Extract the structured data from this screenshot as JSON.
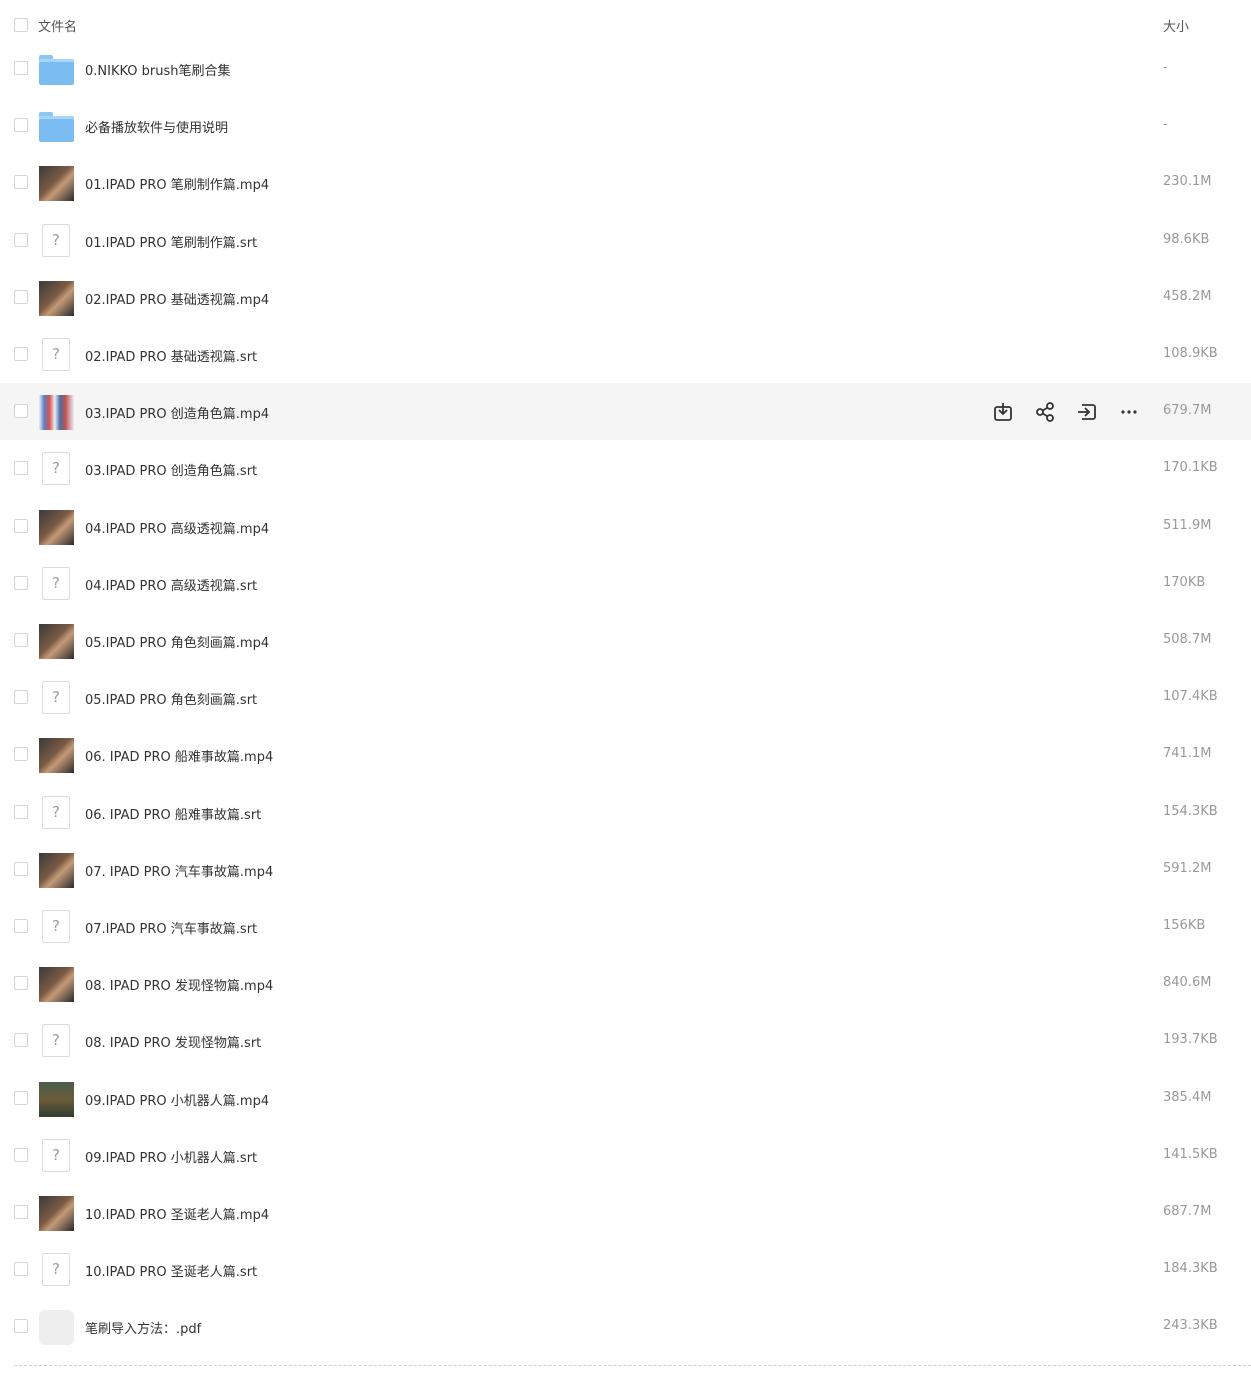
{
  "header": {
    "name_label": "文件名",
    "size_label": "大小"
  },
  "actions_icons": [
    "download-icon",
    "share-icon",
    "move-icon",
    "more-icon"
  ],
  "files": [
    {
      "name": "0.NIKKO brush笔刷合集",
      "size": "-",
      "type": "folder"
    },
    {
      "name": "必备播放软件与使用说明",
      "size": "-",
      "type": "folder"
    },
    {
      "name": "01.IPAD PRO 笔刷制作篇.mp4",
      "size": "230.1M",
      "type": "video"
    },
    {
      "name": "01.IPAD PRO 笔刷制作篇.srt",
      "size": "98.6KB",
      "type": "unknown"
    },
    {
      "name": "02.IPAD PRO 基础透视篇.mp4",
      "size": "458.2M",
      "type": "video"
    },
    {
      "name": "02.IPAD PRO 基础透视篇.srt",
      "size": "108.9KB",
      "type": "unknown"
    },
    {
      "name": "03.IPAD PRO 创造角色篇.mp4",
      "size": "679.7M",
      "type": "video-multi"
    },
    {
      "name": "03.IPAD PRO 创造角色篇.srt",
      "size": "170.1KB",
      "type": "unknown"
    },
    {
      "name": "04.IPAD PRO 高级透视篇.mp4",
      "size": "511.9M",
      "type": "video"
    },
    {
      "name": "04.IPAD PRO 高级透视篇.srt",
      "size": "170KB",
      "type": "unknown"
    },
    {
      "name": "05.IPAD PRO 角色刻画篇.mp4",
      "size": "508.7M",
      "type": "video"
    },
    {
      "name": "05.IPAD PRO 角色刻画篇.srt",
      "size": "107.4KB",
      "type": "unknown"
    },
    {
      "name": "06. IPAD PRO 船难事故篇.mp4",
      "size": "741.1M",
      "type": "video"
    },
    {
      "name": "06. IPAD PRO 船难事故篇.srt",
      "size": "154.3KB",
      "type": "unknown"
    },
    {
      "name": "07. IPAD PRO 汽车事故篇.mp4",
      "size": "591.2M",
      "type": "video"
    },
    {
      "name": "07.IPAD PRO 汽车事故篇.srt",
      "size": "156KB",
      "type": "unknown"
    },
    {
      "name": "08. IPAD PRO 发现怪物篇.mp4",
      "size": "840.6M",
      "type": "video"
    },
    {
      "name": "08. IPAD PRO 发现怪物篇.srt",
      "size": "193.7KB",
      "type": "unknown"
    },
    {
      "name": "09.IPAD PRO 小机器人篇.mp4",
      "size": "385.4M",
      "type": "video-scene"
    },
    {
      "name": "09.IPAD PRO 小机器人篇.srt",
      "size": "141.5KB",
      "type": "unknown"
    },
    {
      "name": "10.IPAD PRO 圣诞老人篇.mp4",
      "size": "687.7M",
      "type": "video"
    },
    {
      "name": "10.IPAD PRO 圣诞老人篇.srt",
      "size": "184.3KB",
      "type": "unknown"
    },
    {
      "name": "笔刷导入方法：.pdf",
      "size": "243.3KB",
      "type": "blank"
    }
  ]
}
